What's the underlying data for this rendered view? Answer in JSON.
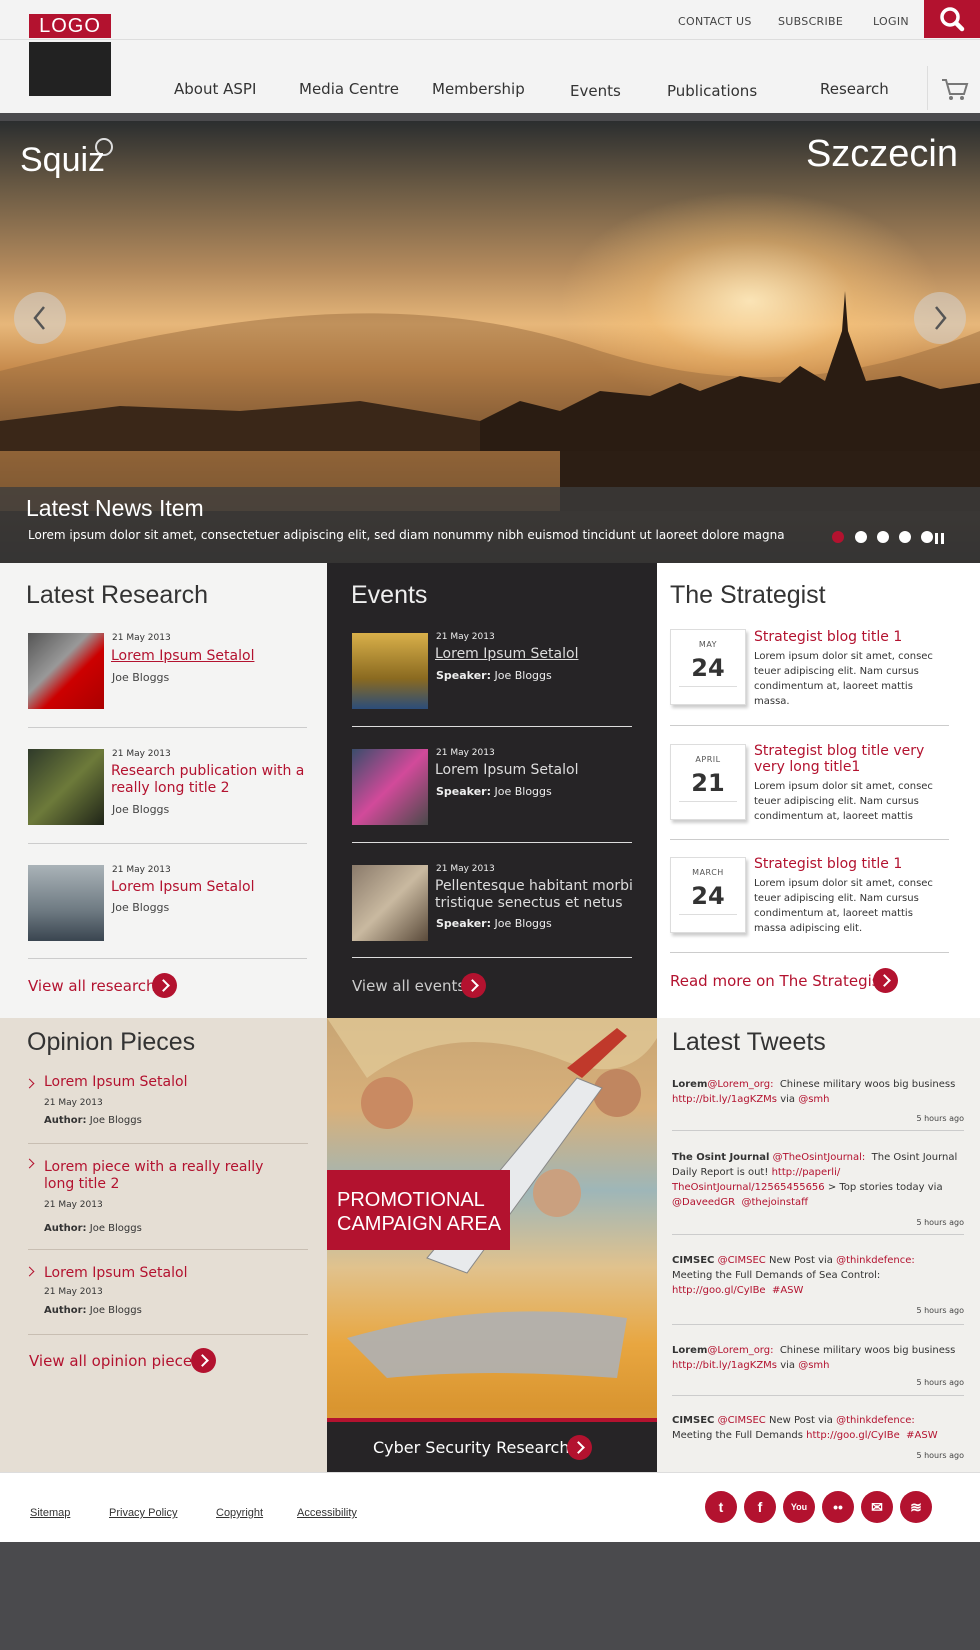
{
  "header": {
    "logo_text": "LOGO",
    "top_links": [
      "CONTACT US",
      "SUBSCRIBE",
      "LOGIN"
    ],
    "nav": [
      "About ASPI",
      "Media Centre",
      "Membership",
      "Events",
      "Publications",
      "Research"
    ]
  },
  "hero": {
    "brand": "Squiz",
    "city": "Szczecin",
    "caption_title": "Latest News Item",
    "caption_text": "Lorem ipsum dolor sit amet, consectetuer adipiscing elit, sed diam nonummy nibh euismod tincidunt ut laoreet dolore magna",
    "slide_count": 5,
    "active_slide": 1
  },
  "research": {
    "heading": "Latest Research",
    "items": [
      {
        "date": "21 May 2013",
        "title": "Lorem Ipsum Setalol",
        "author": "Joe Bloggs"
      },
      {
        "date": "21 May 2013",
        "title": "Research publication with a really long title 2",
        "author": "Joe Bloggs"
      },
      {
        "date": "21 May 2013",
        "title": "Lorem Ipsum Setalol",
        "author": "Joe Bloggs"
      }
    ],
    "view_all": "View all research"
  },
  "events": {
    "heading": "Events",
    "speaker_label": "Speaker:",
    "items": [
      {
        "date": "21 May 2013",
        "title": "Lorem Ipsum Setalol",
        "speaker": "Joe Bloggs"
      },
      {
        "date": "21 May 2013",
        "title": "Lorem Ipsum Setalol",
        "speaker": "Joe Bloggs"
      },
      {
        "date": "21 May 2013",
        "title": "Pellentesque habitant morbi tristique senectus et netus",
        "speaker": "Joe Bloggs"
      }
    ],
    "view_all": "View all events"
  },
  "strategist": {
    "heading": "The Strategist",
    "items": [
      {
        "month": "MAY",
        "day": "24",
        "title": "Strategist blog title 1",
        "body": "Lorem ipsum dolor sit amet, consec teuer adipiscing elit. Nam cursus condimentum at, laoreet mattis massa."
      },
      {
        "month": "APRIL",
        "day": "21",
        "title": "Strategist blog title very very long title1",
        "body": "Lorem ipsum dolor sit amet, consec teuer adipiscing elit. Nam cursus condimentum at, laoreet mattis"
      },
      {
        "month": "MARCH",
        "day": "24",
        "title": "Strategist blog title 1",
        "body": "Lorem ipsum dolor sit amet, consec teuer adipiscing elit. Nam cursus condimentum at, laoreet mattis massa adipiscing elit."
      }
    ],
    "read_more": "Read more on The Strategist"
  },
  "opinion": {
    "heading": "Opinion Pieces",
    "author_label": "Author:",
    "items": [
      {
        "title": "Lorem Ipsum Setalol",
        "date": "21 May 2013",
        "author": "Joe Bloggs"
      },
      {
        "title": "Lorem piece with a really really long title 2",
        "date": "21 May 2013",
        "author": "Joe Bloggs"
      },
      {
        "title": "Lorem Ipsum Setalol",
        "date": "21 May 2013",
        "author": "Joe Bloggs"
      }
    ],
    "view_all": "View all opinion pieces"
  },
  "promo": {
    "label_line1": "PROMOTIONAL",
    "label_line2": "CAMPAIGN AREA",
    "cta": "Cyber Security Research"
  },
  "tweets": {
    "heading": "Latest Tweets",
    "items": [
      {
        "author": "Lorem",
        "handle": "@Lorem_org:",
        "text": "Chinese military woos big business",
        "link": "http://bit.ly/1agKZMs",
        "via": "via",
        "via_handle": "@smh",
        "ago": "5 hours ago"
      },
      {
        "author": "The Osint Journal",
        "handle": "@TheOsintJournal:",
        "text": "The Osint Journal Daily Report is out!",
        "link": "http://paperli/ TheOsintJournal/12565455656",
        "tail": "> Top stories today via",
        "mention1": "@DaveedGR",
        "mention2": "@thejoinstaff",
        "ago": "5 hours ago"
      },
      {
        "author": "CIMSEC",
        "handle": "@CIMSEC",
        "text": "New Post via",
        "mention": "@thinkdefence:",
        "text2": "Meeting the Full Demands of Sea Control:",
        "link": "http://goo.gl/CyIBe",
        "tag": "#ASW",
        "ago": "5 hours ago"
      },
      {
        "author": "Lorem",
        "handle": "@Lorem_org:",
        "text": "Chinese military woos big business",
        "link": "http://bit.ly/1agKZMs",
        "via": "via",
        "via_handle": "@smh",
        "ago": "5 hours ago"
      },
      {
        "author": "CIMSEC",
        "handle": "@CIMSEC",
        "text": "New Post via",
        "mention": "@thinkdefence:",
        "text2": "Meeting the Full Demands",
        "link": "http://goo.gl/CyIBe",
        "tag": "#ASW",
        "ago": "5 hours ago"
      }
    ]
  },
  "footer": {
    "links": [
      "Sitemap",
      "Privacy Policy",
      "Copyright",
      "Accessibility"
    ],
    "social": [
      "twitter-icon",
      "facebook-icon",
      "youtube-icon",
      "flickr-icon",
      "email-icon",
      "rss-icon"
    ],
    "social_glyphs": [
      "t",
      "f",
      "You",
      "••",
      "✉",
      "≋"
    ]
  },
  "colors": {
    "accent": "#b3122f",
    "dark": "#262426",
    "beige": "#e5ded4"
  }
}
